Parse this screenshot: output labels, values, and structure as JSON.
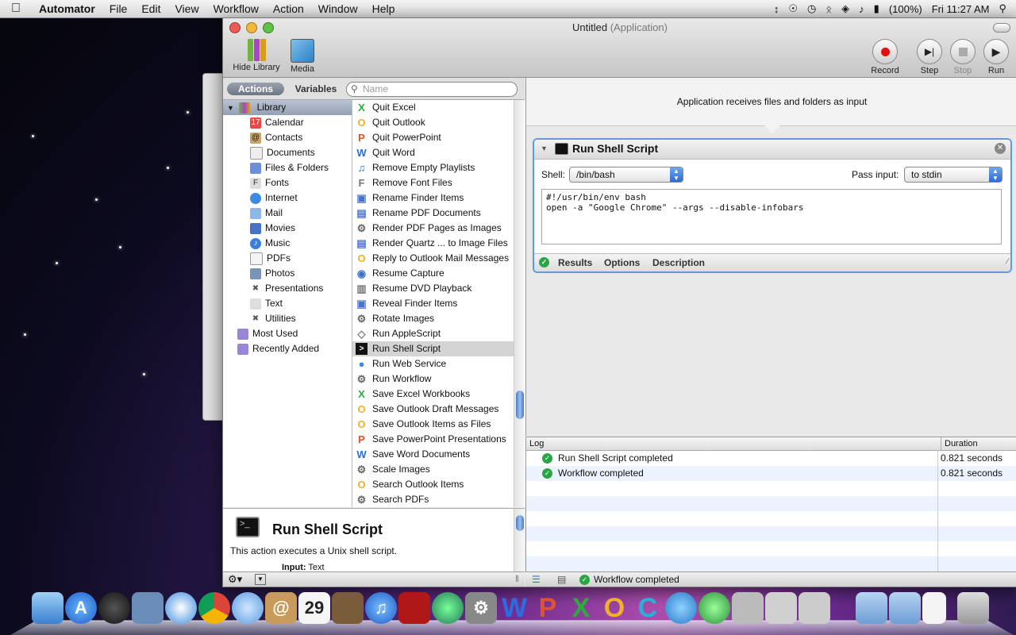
{
  "menubar": {
    "app": "Automator",
    "items": [
      "File",
      "Edit",
      "View",
      "Workflow",
      "Action",
      "Window",
      "Help"
    ],
    "battery": "(100%)",
    "clock": "Fri 11:27 AM"
  },
  "window": {
    "title": "Untitled",
    "subtitle": "(Application)",
    "toolbar": {
      "hide_library": "Hide Library",
      "media": "Media",
      "record": "Record",
      "step": "Step",
      "stop": "Stop",
      "run": "Run"
    }
  },
  "library_tabs": {
    "actions": "Actions",
    "variables": "Variables",
    "search_placeholder": "Name"
  },
  "library": {
    "header": "Library",
    "items": [
      "Calendar",
      "Contacts",
      "Documents",
      "Files & Folders",
      "Fonts",
      "Internet",
      "Mail",
      "Movies",
      "Music",
      "PDFs",
      "Photos",
      "Presentations",
      "Text",
      "Utilities"
    ],
    "extra": [
      "Most Used",
      "Recently Added"
    ]
  },
  "actions": [
    {
      "label": "Quit Excel",
      "icon": "excel-icon"
    },
    {
      "label": "Quit Outlook",
      "icon": "outlook-icon"
    },
    {
      "label": "Quit PowerPoint",
      "icon": "powerpoint-icon"
    },
    {
      "label": "Quit Word",
      "icon": "word-icon"
    },
    {
      "label": "Remove Empty Playlists",
      "icon": "itunes-icon"
    },
    {
      "label": "Remove Font Files",
      "icon": "font-icon"
    },
    {
      "label": "Rename Finder Items",
      "icon": "finder-icon"
    },
    {
      "label": "Rename PDF Documents",
      "icon": "pdf-icon"
    },
    {
      "label": "Render PDF Pages as Images",
      "icon": "automator-icon"
    },
    {
      "label": "Render Quartz ... to Image Files",
      "icon": "quartz-icon"
    },
    {
      "label": "Reply to Outlook Mail Messages",
      "icon": "outlook-icon"
    },
    {
      "label": "Resume Capture",
      "icon": "capture-icon"
    },
    {
      "label": "Resume DVD Playback",
      "icon": "dvd-icon"
    },
    {
      "label": "Reveal Finder Items",
      "icon": "finder-icon"
    },
    {
      "label": "Rotate Images",
      "icon": "automator-icon"
    },
    {
      "label": "Run AppleScript",
      "icon": "applescript-icon"
    },
    {
      "label": "Run Shell Script",
      "icon": "terminal-icon",
      "selected": true
    },
    {
      "label": "Run Web Service",
      "icon": "globe-icon"
    },
    {
      "label": "Run Workflow",
      "icon": "automator-icon"
    },
    {
      "label": "Save Excel Workbooks",
      "icon": "excel-icon"
    },
    {
      "label": "Save Outlook Draft Messages",
      "icon": "outlook-icon"
    },
    {
      "label": "Save Outlook Items as Files",
      "icon": "outlook-icon"
    },
    {
      "label": "Save PowerPoint Presentations",
      "icon": "powerpoint-icon"
    },
    {
      "label": "Save Word Documents",
      "icon": "word-icon"
    },
    {
      "label": "Scale Images",
      "icon": "automator-icon"
    },
    {
      "label": "Search Outlook Items",
      "icon": "outlook-icon"
    },
    {
      "label": "Search PDFs",
      "icon": "automator-icon"
    }
  ],
  "description": {
    "title": "Run Shell Script",
    "text": "This action executes a Unix shell script.",
    "input_label": "Input:",
    "input_value": "Text"
  },
  "workflow": {
    "input_text": "Application receives files and folders as input",
    "action": {
      "title": "Run Shell Script",
      "shell_label": "Shell:",
      "shell_value": "/bin/bash",
      "pass_label": "Pass input:",
      "pass_value": "to stdin",
      "script_line1": "#!/usr/bin/env bash",
      "script_line2": "open -a \"Google Chrome\" --args --disable-infobars",
      "tabs": [
        "Results",
        "Options",
        "Description"
      ]
    }
  },
  "log": {
    "col_log": "Log",
    "col_duration": "Duration",
    "rows": [
      {
        "text": "Run Shell Script completed",
        "duration": "0.821 seconds"
      },
      {
        "text": "Workflow completed",
        "duration": "0.821 seconds"
      }
    ]
  },
  "status": "Workflow completed",
  "colors": {
    "accent": "#5d9be6",
    "success": "#2aa545",
    "record": "#e01010"
  }
}
